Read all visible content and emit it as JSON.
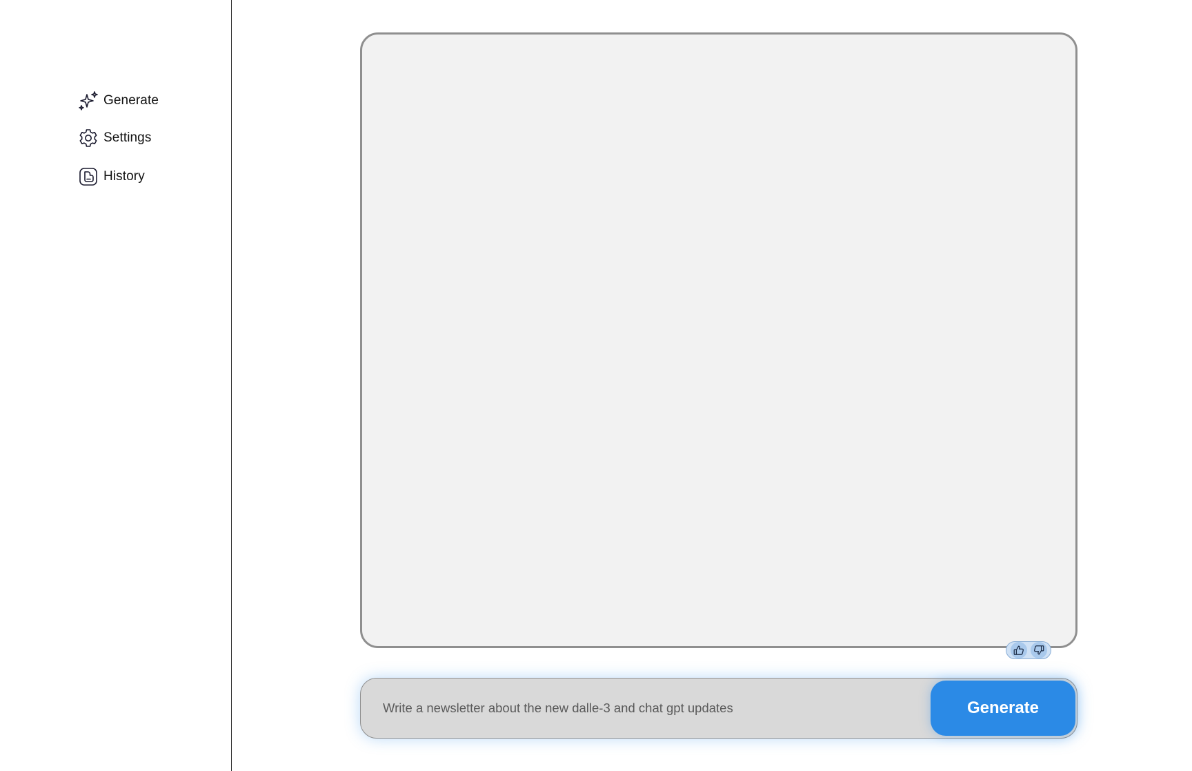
{
  "sidebar": {
    "items": [
      {
        "label": "Generate",
        "icon": "sparkles-icon"
      },
      {
        "label": "Settings",
        "icon": "gear-icon"
      },
      {
        "label": "History",
        "icon": "history-icon"
      }
    ]
  },
  "output": {
    "content": "",
    "feedback": {
      "up_icon": "thumbs-up-icon",
      "down_icon": "thumbs-down-icon"
    }
  },
  "prompt": {
    "value": "Write a newsletter about the new dalle-3 and chat gpt updates",
    "generate_label": "Generate"
  },
  "colors": {
    "accent": "#2b8ae6",
    "panel_bg": "#f2f2f2",
    "panel_border": "#8f8f8f",
    "input_bg": "#d9d9d9",
    "feedback_bg": "#cfe1f5"
  }
}
